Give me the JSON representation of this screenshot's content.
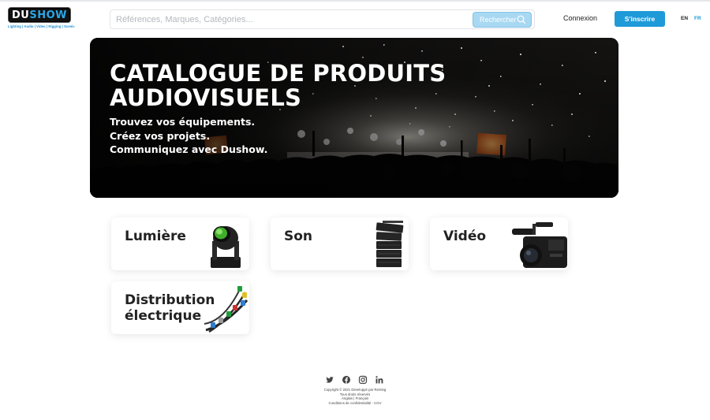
{
  "header": {
    "logo": {
      "text_a": "DU",
      "text_b": "SHOW",
      "tagline": "Lighting | Audio | Video | Rigging | Scenic"
    },
    "search": {
      "placeholder": "Références, Marques, Catégories...",
      "button_label": "Rechercher"
    },
    "login_label": "Connexion",
    "signup_label": "S'inscrire",
    "languages": {
      "en": "EN",
      "fr": "FR",
      "active": "FR"
    }
  },
  "hero": {
    "title_line1": "CATALOGUE DE PRODUITS",
    "title_line2": "AUDIOVISUELS",
    "subtitle_line1": "Trouvez vos équipements.",
    "subtitle_line2": "Créez vos projets.",
    "subtitle_line3": "Communiquez avec Dushow."
  },
  "categories": [
    {
      "label": "Lumière",
      "icon": "moving-head-light-icon"
    },
    {
      "label": "Son",
      "icon": "line-array-speaker-icon"
    },
    {
      "label": "Vidéo",
      "icon": "video-camera-icon"
    },
    {
      "label_line1": "Distribution",
      "label_line2": "électrique",
      "icon": "power-cables-icon"
    }
  ],
  "footer": {
    "social": [
      "twitter-icon",
      "facebook-icon",
      "instagram-icon",
      "linkedin-icon"
    ],
    "copyright": "Copyright © 2021 Développé par Renting",
    "rights": "Tous droits réservés",
    "lang_en": "Anglais",
    "lang_sep": "|",
    "lang_fr": "Français",
    "privacy": "Conditions de confidentialité",
    "privacy_sep": "-",
    "cgv": "CGV"
  },
  "colors": {
    "accent": "#1e9ad9",
    "search_button": "#a8d8f2",
    "text": "#222222"
  }
}
